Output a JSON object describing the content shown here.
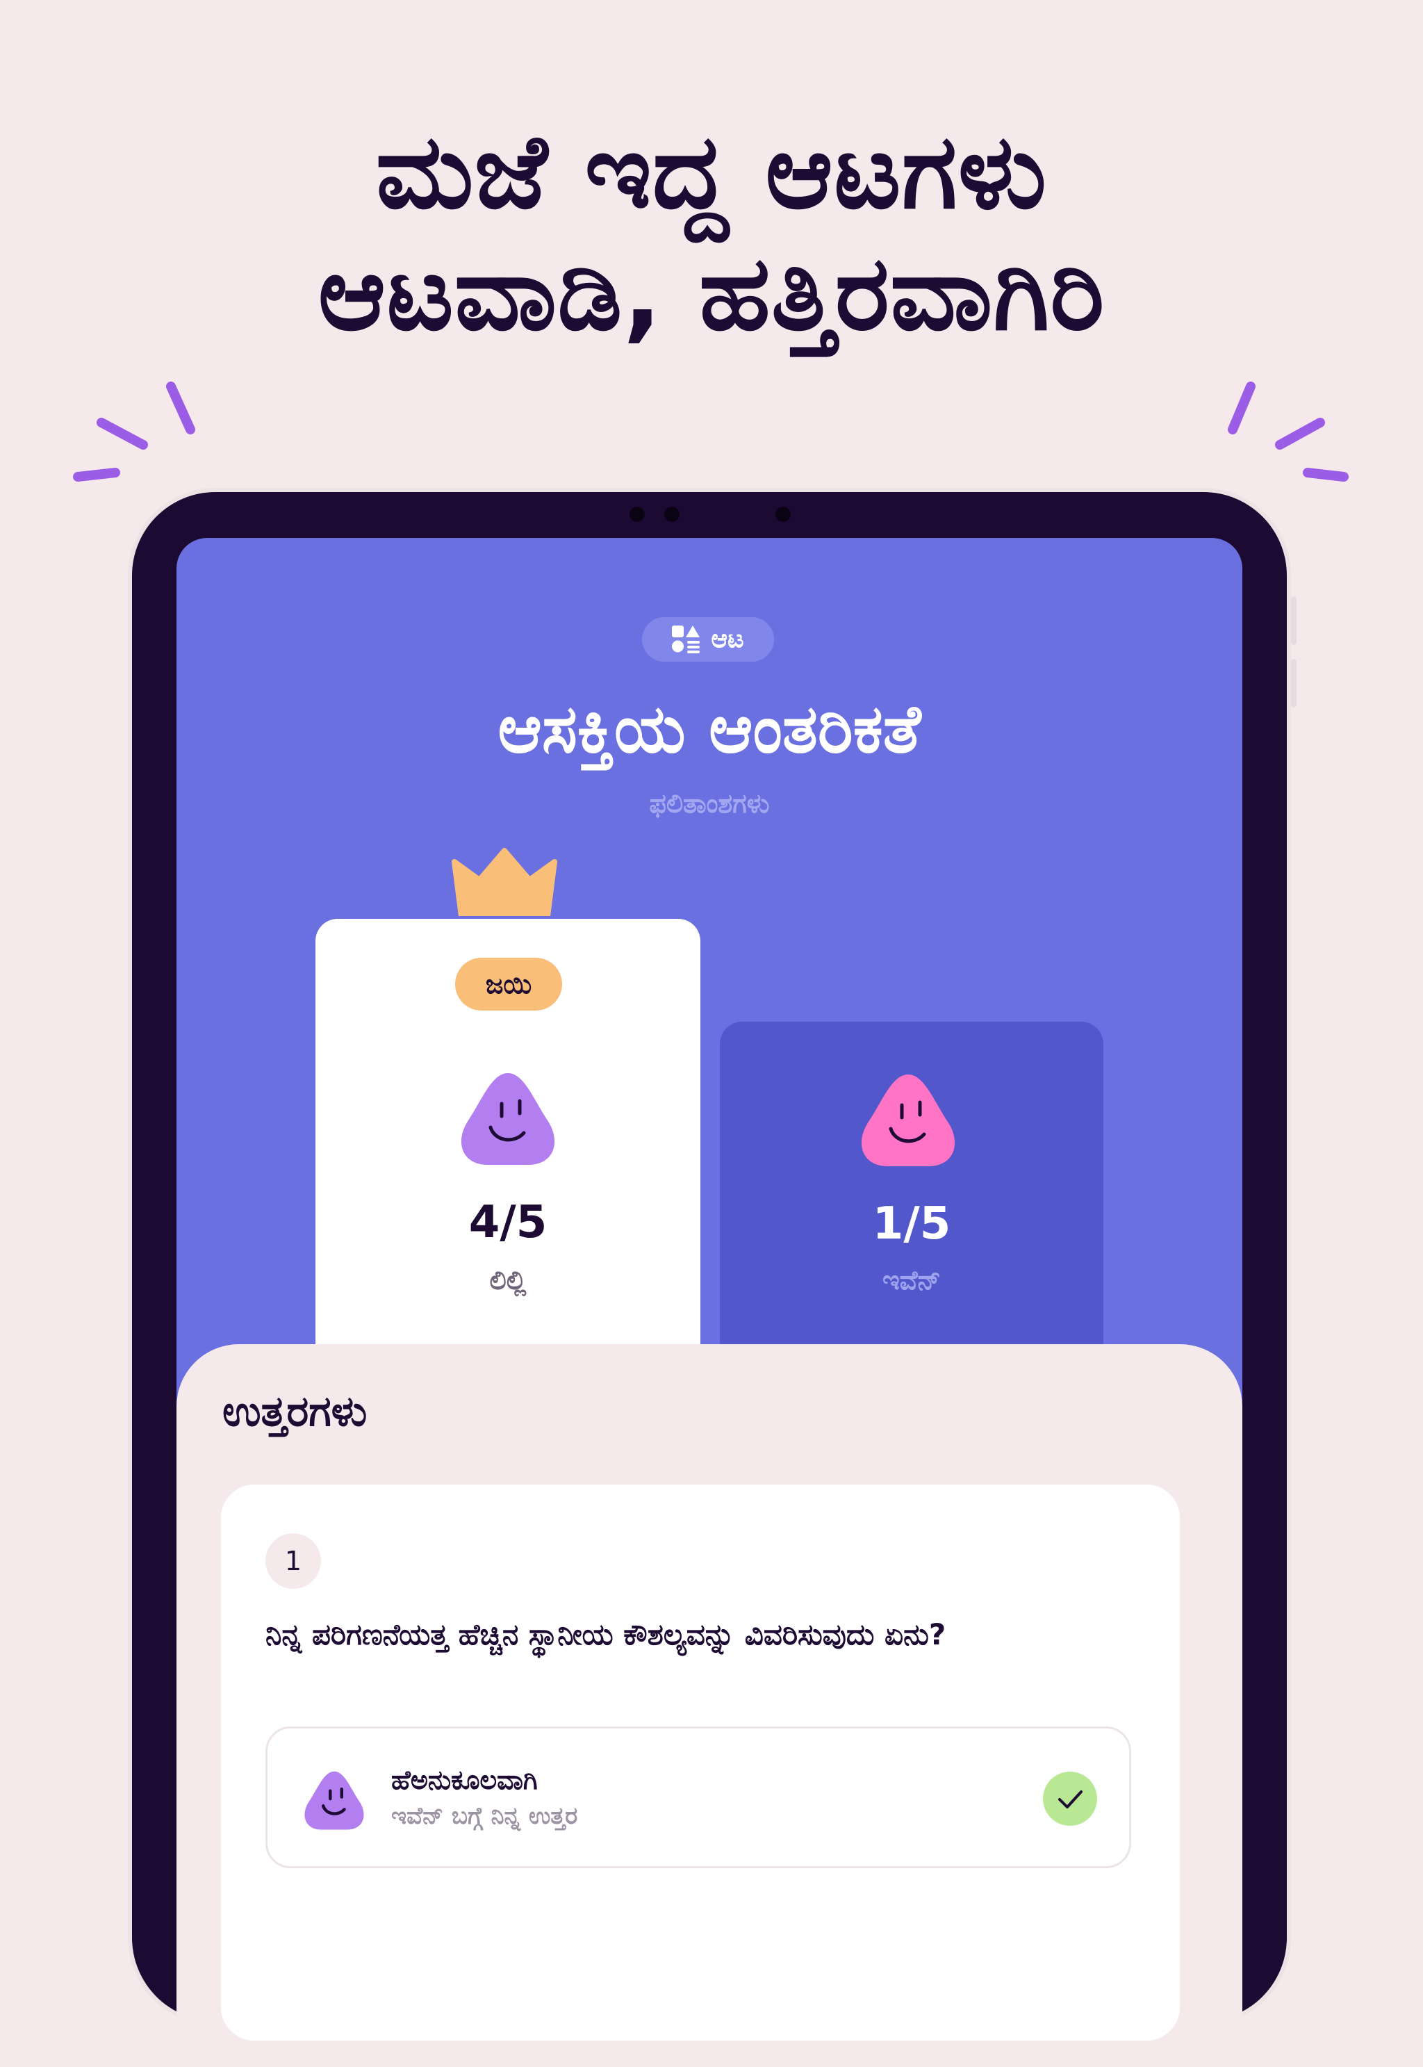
{
  "headline": {
    "line1": "ಮಜೆ ಇದ್ದ ಆಟಗಳು",
    "line2": "ಆಟವಾಡಿ, ಹತ್ತಿರವಾಗಿರಿ"
  },
  "game_badge": {
    "icon": "shapes-icon",
    "label": "ಆಟ"
  },
  "quiz": {
    "title": "ಆಸಕ್ತಿಯ ಆಂತರಿಕತೆ",
    "subtitle": "ಫಲಿತಾಂಶಗಳು"
  },
  "players": [
    {
      "name": "ಲಿಲ್ಲಿ",
      "score": "4/5",
      "badge": "ಜಯಿ",
      "avatar_color": "#b27ef0",
      "card_color": "#ffffff"
    },
    {
      "name": "ಇವೆನ್",
      "score": "1/5",
      "avatar_color": "#ff74c4",
      "card_color": "#5258cc"
    }
  ],
  "answers": {
    "heading": "ಉತ್ತರಗಳು",
    "question_number": "1",
    "question": "ನಿನ್ನ ಪರಿಗಣನೆಯತ್ತ ಹೆಚ್ಚಿನ ಸ್ಥಾನೀಯ ಕೌಶಲ್ಯವನ್ನು ವಿವರಿಸುವುದು ಏನು?",
    "answer_title": "ಹೆಅನುಕೂಲವಾಗಿ",
    "answer_sub": "ಇವೆನ್ ಬಗ್ಗೆ ನಿನ್ನ ಉತ್ತರ",
    "answer_status_icon": "checkmark-icon"
  },
  "colors": {
    "background": "#f6e9ec",
    "screen": "#6a70e0",
    "accent_purple": "#9b5ce6",
    "crown": "#f9be78",
    "correct": "#b8e894"
  }
}
